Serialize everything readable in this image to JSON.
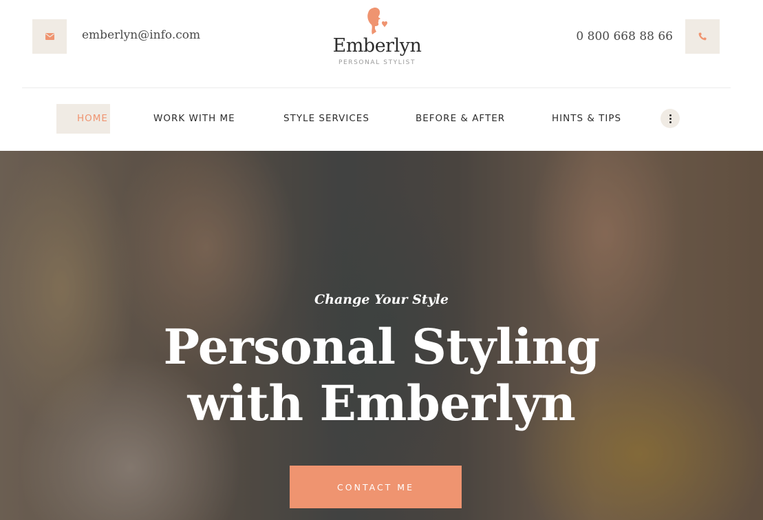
{
  "header": {
    "email": "emberlyn@info.com",
    "email_icon": "envelope-icon",
    "phone": "0 800 668 88 66",
    "phone_icon": "phone-icon",
    "logo": {
      "name": "Emberlyn",
      "tagline": "PERSONAL STYLIST",
      "icon": "woman-profile-heart-icon"
    }
  },
  "nav": {
    "items": [
      {
        "label": "HOME",
        "active": true
      },
      {
        "label": "WORK WITH ME",
        "active": false
      },
      {
        "label": "STYLE SERVICES",
        "active": false
      },
      {
        "label": "BEFORE & AFTER",
        "active": false
      },
      {
        "label": "HINTS & TIPS",
        "active": false
      }
    ],
    "more_icon": "vertical-dots-icon"
  },
  "hero": {
    "subtitle": "Change Your Style",
    "title_line1": "Personal Styling",
    "title_line2": "with Emberlyn",
    "cta_label": "CONTACT ME"
  },
  "colors": {
    "accent": "#ef9470",
    "icon_bg": "#f0ebe4",
    "text_dark": "#2d2d2d",
    "text_muted": "#9a9a9a"
  }
}
